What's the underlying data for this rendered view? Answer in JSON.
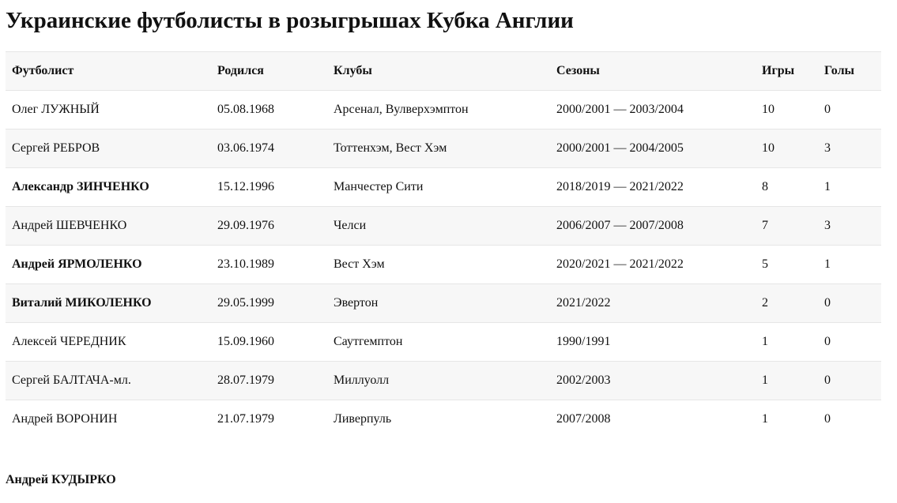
{
  "page": {
    "title": "Украинские футболисты в розыгрышах Кубка Англии"
  },
  "table": {
    "headers": {
      "player": "Футболист",
      "born": "Родился",
      "clubs": "Клубы",
      "seasons": "Сезоны",
      "games": "Игры",
      "goals": "Голы"
    },
    "rows": [
      {
        "player": "Олег ЛУЖНЫЙ",
        "bold": false,
        "born": "05.08.1968",
        "clubs": "Арсенал, Вулверхэмптон",
        "seasons": "2000/2001 — 2003/2004",
        "games": "10",
        "goals": "0"
      },
      {
        "player": "Сергей РЕБРОВ",
        "bold": false,
        "born": "03.06.1974",
        "clubs": "Тоттенхэм, Вест Хэм",
        "seasons": "2000/2001 — 2004/2005",
        "games": "10",
        "goals": "3"
      },
      {
        "player": "Александр ЗИНЧЕНКО",
        "bold": true,
        "born": "15.12.1996",
        "clubs": "Манчестер Сити",
        "seasons": "2018/2019 — 2021/2022",
        "games": "8",
        "goals": "1"
      },
      {
        "player": "Андрей ШЕВЧЕНКО",
        "bold": false,
        "born": "29.09.1976",
        "clubs": "Челси",
        "seasons": "2006/2007 — 2007/2008",
        "games": "7",
        "goals": "3"
      },
      {
        "player": "Андрей ЯРМОЛЕНКО",
        "bold": true,
        "born": "23.10.1989",
        "clubs": "Вест Хэм",
        "seasons": "2020/2021 — 2021/2022",
        "games": "5",
        "goals": "1"
      },
      {
        "player": "Виталий МИКОЛЕНКО",
        "bold": true,
        "born": "29.05.1999",
        "clubs": "Эвертон",
        "seasons": "2021/2022",
        "games": "2",
        "goals": "0"
      },
      {
        "player": "Алексей ЧЕРЕДНИК",
        "bold": false,
        "born": "15.09.1960",
        "clubs": "Саутгемптон",
        "seasons": "1990/1991",
        "games": "1",
        "goals": "0"
      },
      {
        "player": "Сергей БАЛТАЧА-мл.",
        "bold": false,
        "born": "28.07.1979",
        "clubs": "Миллуолл",
        "seasons": "2002/2003",
        "games": "1",
        "goals": "0"
      },
      {
        "player": "Андрей ВОРОНИН",
        "bold": false,
        "born": "21.07.1979",
        "clubs": "Ливерпуль",
        "seasons": "2007/2008",
        "games": "1",
        "goals": "0"
      }
    ]
  },
  "footer": {
    "author": "Андрей КУДЫРКО"
  }
}
